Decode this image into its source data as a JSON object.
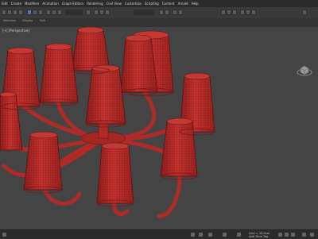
{
  "menu": [
    "Edit",
    "Create",
    "Modifiers",
    "Animation",
    "Graph Editors",
    "Rendering",
    "Civil View",
    "Customize",
    "Scripting",
    "Content",
    "Arnold",
    "Help"
  ],
  "ribbon": {
    "tabs": [
      "Selection",
      "Display",
      "Edit"
    ]
  },
  "viewport": {
    "label": "[+] [Perspective]"
  },
  "status": {
    "grid": "Grid = 10.0cm",
    "time": "Add Time Tag"
  },
  "colors": {
    "shade": "#c8332f",
    "shade_dark": "#8e1d1c",
    "arm": "#b02a28",
    "background": "#444444"
  },
  "icons": [
    "select-icon",
    "move-icon",
    "rotate-icon",
    "scale-icon",
    "render-icon",
    "nav-cube-icon"
  ]
}
